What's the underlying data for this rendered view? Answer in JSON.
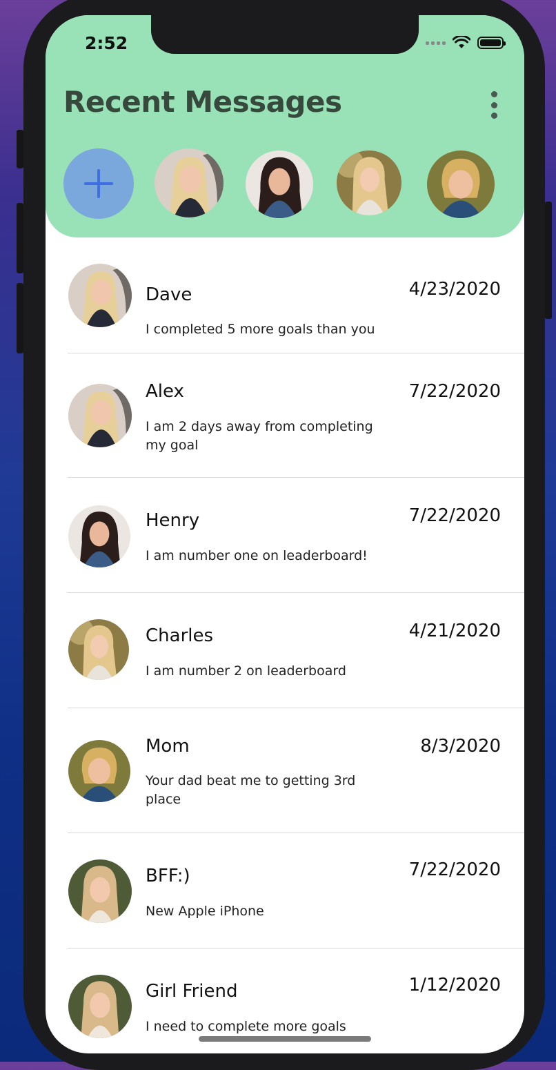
{
  "status_bar": {
    "time": "2:52"
  },
  "header": {
    "title": "Recent Messages"
  },
  "stories": [
    {
      "avatar": "blonde-woman-avatar"
    },
    {
      "avatar": "brunette-woman-avatar"
    },
    {
      "avatar": "long-blonde-woman-avatar"
    },
    {
      "avatar": "short-blonde-woman-avatar"
    }
  ],
  "conversations": [
    {
      "name": "Dave",
      "message": "I completed 5 more goals than you",
      "date": "4/23/2020"
    },
    {
      "name": "Alex",
      "message": "I am 2 days away from completing my goal",
      "date": "7/22/2020"
    },
    {
      "name": "Henry",
      "message": "I am number one on leaderboard!",
      "date": "7/22/2020"
    },
    {
      "name": "Charles",
      "message": "I am number 2 on leaderboard",
      "date": "4/21/2020"
    },
    {
      "name": "Mom",
      "message": "Your dad beat me to getting 3rd place",
      "date": "8/3/2020"
    },
    {
      "name": "BFF:)",
      "message": "New Apple iPhone",
      "date": "7/22/2020"
    },
    {
      "name": "Girl Friend",
      "message": "I need to complete more goals",
      "date": "1/12/2020"
    }
  ],
  "colors": {
    "header_bg": "#99e2b8",
    "add_button_bg": "#7aa7dc",
    "add_icon": "#3f6fe0"
  }
}
